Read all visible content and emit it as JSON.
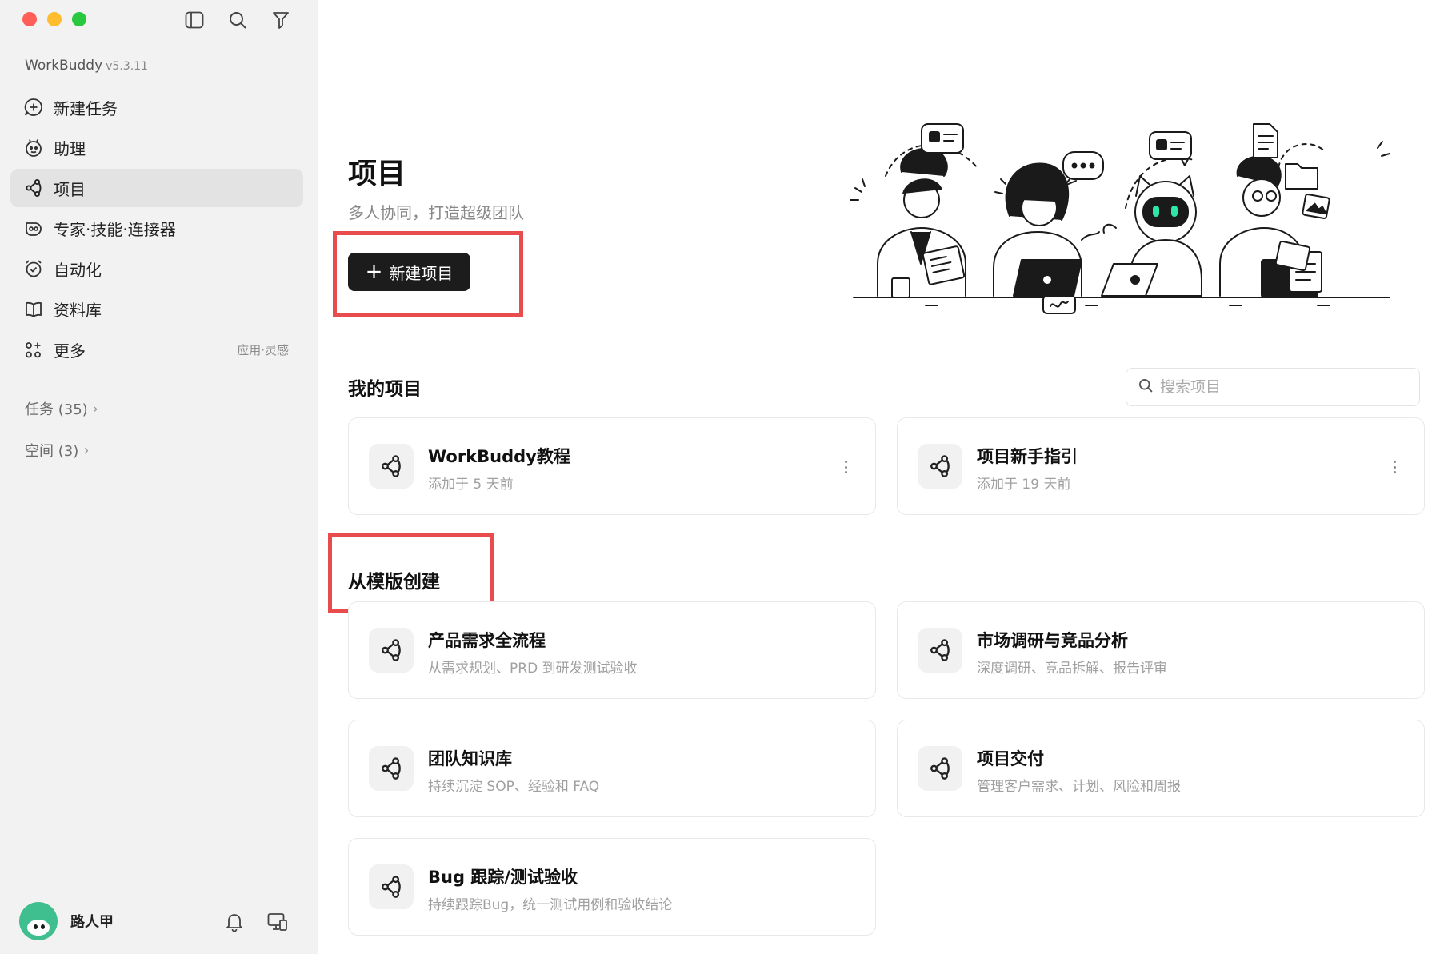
{
  "sidebar": {
    "brand": "WorkBuddy",
    "version": "v5.3.11",
    "nav": [
      {
        "label": "新建任务",
        "icon": "plus-circle-icon"
      },
      {
        "label": "助理",
        "icon": "assistant-icon"
      },
      {
        "label": "项目",
        "icon": "project-icon",
        "active": true
      },
      {
        "label": "专家·技能·连接器",
        "icon": "expert-icon"
      },
      {
        "label": "自动化",
        "icon": "automation-icon"
      },
      {
        "label": "资料库",
        "icon": "library-book-icon"
      },
      {
        "label": "更多",
        "icon": "more-apps-icon",
        "extra": "应用·灵感"
      }
    ],
    "tasks_link": "任务 (35)",
    "spaces_link": "空间 (3)",
    "user_name": "路人甲"
  },
  "main": {
    "title": "项目",
    "subtitle": "多人协同，打造超级团队",
    "new_project_label": "新建项目",
    "my_projects_title": "我的项目",
    "search_placeholder": "搜索项目",
    "my_projects": [
      {
        "title": "WorkBuddy教程",
        "subtitle": "添加于 5 天前"
      },
      {
        "title": "项目新手指引",
        "subtitle": "添加于 19 天前"
      }
    ],
    "templates_title": "从模版创建",
    "templates": [
      {
        "title": "产品需求全流程",
        "subtitle": "从需求规划、PRD 到研发测试验收"
      },
      {
        "title": "市场调研与竞品分析",
        "subtitle": "深度调研、竞品拆解、报告评审"
      },
      {
        "title": "团队知识库",
        "subtitle": "持续沉淀 SOP、经验和 FAQ"
      },
      {
        "title": "项目交付",
        "subtitle": "管理客户需求、计划、风险和周报"
      },
      {
        "title": "Bug 跟踪/测试验收",
        "subtitle": "持续跟踪Bug，统一测试用例和验收结论"
      }
    ]
  },
  "colors": {
    "sidebar_bg": "#f2f2f2",
    "active_nav_bg": "#e3e3e3",
    "primary_button": "#1c1c1c",
    "highlight_box": "#e84c4c"
  }
}
